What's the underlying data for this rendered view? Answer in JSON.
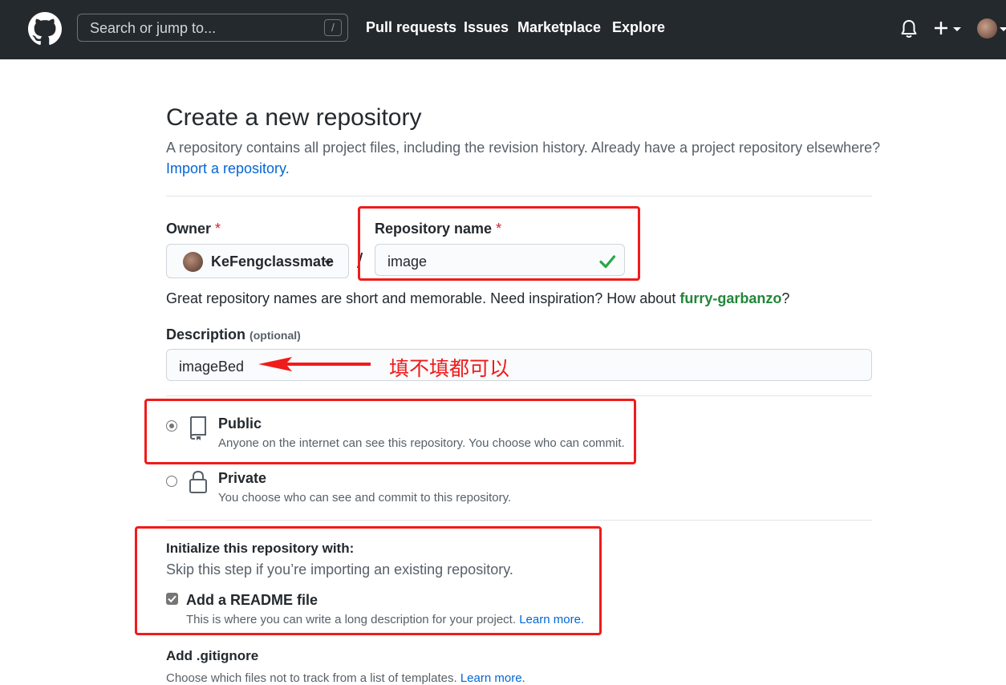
{
  "header": {
    "search_placeholder": "Search or jump to...",
    "search_shortcut": "/",
    "nav": [
      "Pull requests",
      "Issues",
      "Marketplace",
      "Explore"
    ]
  },
  "page": {
    "title": "Create a new repository",
    "subtitle": "A repository contains all project files, including the revision history. Already have a project repository elsewhere?",
    "import_link": "Import a repository."
  },
  "owner": {
    "label": "Owner",
    "required_mark": "*",
    "value": "KeFengclassmate"
  },
  "repo": {
    "separator": "/",
    "label": "Repository name",
    "required_mark": "*",
    "value": "image"
  },
  "name_hint": {
    "text": "Great repository names are short and memorable. Need inspiration? How about",
    "suggestion": "furry-garbanzo",
    "end": "?"
  },
  "description": {
    "label": "Description",
    "optional": "(optional)",
    "value": "imageBed"
  },
  "annotation": "填不填都可以",
  "visibility": {
    "public": {
      "title": "Public",
      "desc": "Anyone on the internet can see this repository. You choose who can commit.",
      "checked": true
    },
    "private": {
      "title": "Private",
      "desc": "You choose who can see and commit to this repository.",
      "checked": false
    }
  },
  "init": {
    "title": "Initialize this repository with:",
    "subtitle": "Skip this step if you’re importing an existing repository.",
    "readme_label": "Add a README file",
    "readme_desc": "This is where you can write a long description for your project.",
    "readme_link": "Learn more.",
    "readme_checked": true
  },
  "gitignore": {
    "title": "Add .gitignore",
    "desc": "Choose which files not to track from a list of templates.",
    "link": "Learn more."
  },
  "colors": {
    "header_bg": "#24292e",
    "link": "#0366d6",
    "suggestion": "#22863a",
    "annotation_red": "#f01b1b",
    "check_green": "#28a745"
  }
}
